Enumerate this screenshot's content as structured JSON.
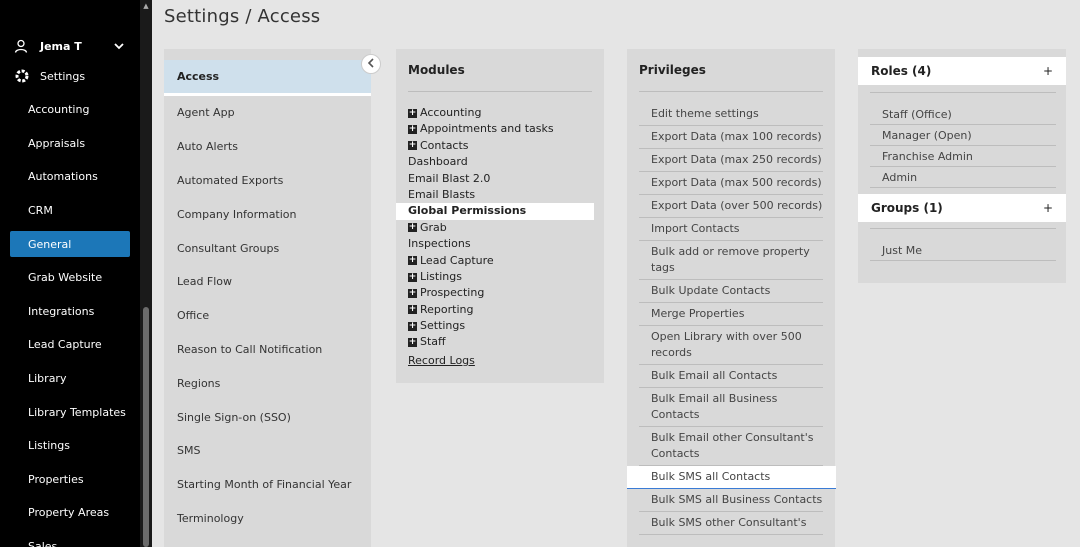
{
  "sidebar": {
    "user_name": "Jema T",
    "settings_label": "Settings",
    "items": [
      {
        "label": "Accounting"
      },
      {
        "label": "Appraisals"
      },
      {
        "label": "Automations"
      },
      {
        "label": "CRM"
      },
      {
        "label": "General",
        "active": true
      },
      {
        "label": "Grab Website"
      },
      {
        "label": "Integrations"
      },
      {
        "label": "Lead Capture"
      },
      {
        "label": "Library"
      },
      {
        "label": "Library Templates"
      },
      {
        "label": "Listings"
      },
      {
        "label": "Properties"
      },
      {
        "label": "Property Areas"
      },
      {
        "label": "Sales"
      }
    ]
  },
  "header": {
    "title": "Settings / Access"
  },
  "settings_list": {
    "items": [
      "Access",
      "Agent App",
      "Auto Alerts",
      "Automated Exports",
      "Company Information",
      "Consultant Groups",
      "Lead Flow",
      "Office",
      "Reason to Call Notification",
      "Regions",
      "Single Sign-on (SSO)",
      "SMS",
      "Starting Month of Financial Year",
      "Terminology"
    ],
    "active": "Access"
  },
  "modules": {
    "title": "Modules",
    "items": [
      {
        "label": "Accounting",
        "expandable": true
      },
      {
        "label": "Appointments and tasks",
        "expandable": true
      },
      {
        "label": "Contacts",
        "expandable": true
      },
      {
        "label": "Dashboard",
        "expandable": false
      },
      {
        "label": "Email Blast 2.0",
        "expandable": false
      },
      {
        "label": "Email Blasts",
        "expandable": false
      },
      {
        "label": "Global Permissions",
        "expandable": false,
        "selected": true
      },
      {
        "label": "Grab",
        "expandable": true
      },
      {
        "label": "Inspections",
        "expandable": false
      },
      {
        "label": "Lead Capture",
        "expandable": true
      },
      {
        "label": "Listings",
        "expandable": true
      },
      {
        "label": "Prospecting",
        "expandable": true
      },
      {
        "label": "Reporting",
        "expandable": true
      },
      {
        "label": "Settings",
        "expandable": true
      },
      {
        "label": "Staff",
        "expandable": true
      }
    ],
    "record_logs": "Record Logs"
  },
  "privileges": {
    "title": "Privileges",
    "items": [
      "Edit theme settings",
      "Export Data (max 100 records)",
      "Export Data (max 250 records)",
      "Export Data (max 500 records)",
      "Export Data (over 500 records)",
      "Import Contacts",
      "Bulk add or remove property tags",
      "Bulk Update Contacts",
      "Merge Properties",
      "Open Library with over 500 records",
      "Bulk Email all Contacts",
      "Bulk Email all Business Contacts",
      "Bulk Email other Consultant's Contacts",
      "Bulk SMS all Contacts",
      "Bulk SMS all Business Contacts",
      "Bulk SMS other Consultant's"
    ],
    "selected": "Bulk SMS all Contacts"
  },
  "roles": {
    "title": "Roles (4)",
    "add": "+",
    "items": [
      "Staff (Office)",
      "Manager (Open)",
      "Franchise Admin",
      "Admin"
    ]
  },
  "groups": {
    "title": "Groups (1)",
    "add": "+",
    "items": [
      "Just Me"
    ]
  },
  "colors": {
    "sidebar_bg": "#000000",
    "active_nav": "#1c77b8",
    "panel_bg": "#d9d9d9",
    "page_bg": "#e5e5e5"
  },
  "icons": {
    "user": "user-icon",
    "settings": "gear-icon",
    "collapse": "chevron-left-icon",
    "expand": "plus-box-icon"
  }
}
